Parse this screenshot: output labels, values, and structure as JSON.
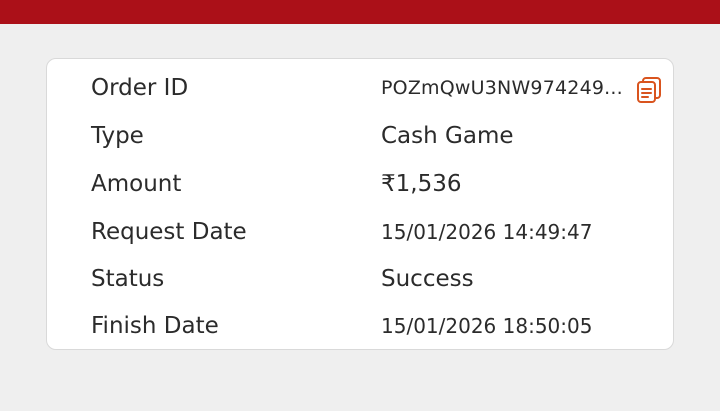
{
  "header": {
    "accent_color": "#ab1018"
  },
  "details": {
    "order_id": {
      "label": "Order ID",
      "value": "POZmQwU3NW974249...",
      "copy_icon": "copy-icon",
      "copy_icon_color": "#d9541e"
    },
    "type": {
      "label": "Type",
      "value": "Cash Game"
    },
    "amount": {
      "label": "Amount",
      "value": "₹1,536"
    },
    "request_date": {
      "label": "Request Date",
      "value": "15/01/2026 14:49:47"
    },
    "status": {
      "label": "Status",
      "value": "Success"
    },
    "finish_date": {
      "label": "Finish Date",
      "value": "15/01/2026 18:50:05"
    }
  }
}
